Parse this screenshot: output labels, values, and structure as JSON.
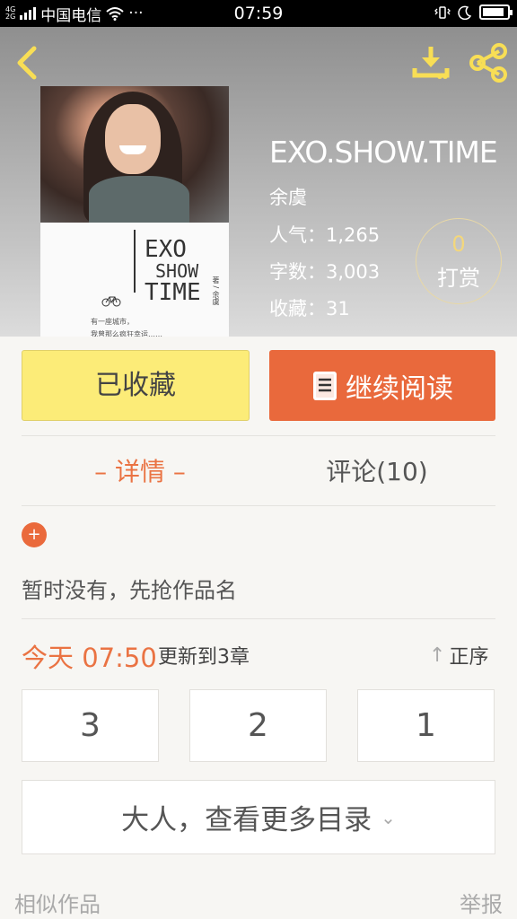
{
  "status_bar": {
    "network_top": "4G",
    "network_bottom": "2G",
    "carrier": "中国电信",
    "wifi_icon": "wifi-icon",
    "more": "···",
    "time": "07:59",
    "vibrate_icon": "vibrate-icon",
    "moon_icon": "moon-icon",
    "battery_level": 0.9
  },
  "header": {
    "back_icon": "chevron-left-icon",
    "download_icon": "download-icon",
    "share_icon": "share-icon"
  },
  "cover": {
    "title_line1": "EXO",
    "title_line2": "SHOW",
    "title_line3": "TIME",
    "bike_icon": "bicycle-icon",
    "tagline": "有一座城市，\n我曾那么疯狂幸运……",
    "author_vertical": "著 / 余虞"
  },
  "book": {
    "title": "EXO.SHOW.TIME",
    "author": "余虞",
    "popularity": "人气：1,265",
    "word_count": "字数：3,003",
    "favorites": "收藏：31"
  },
  "reward": {
    "count": "0",
    "label": "打赏"
  },
  "actions": {
    "favorited_label": "已收藏",
    "continue_label": "继续阅读",
    "book_icon": "book-icon"
  },
  "tabs": {
    "detail": "– 详情 –",
    "comments": "评论(10)"
  },
  "detail": {
    "plus": "+",
    "no_work_name": "暂时没有，先抢作品名"
  },
  "update": {
    "today": "今天 07:50",
    "text": "更新到3章",
    "sort_arrow": "↑",
    "sort_label": "正序"
  },
  "chapters": [
    "3",
    "2",
    "1"
  ],
  "more_catalog": {
    "label": "大人，查看更多目录",
    "chevron": "⌄"
  },
  "footer": {
    "similar": "相似作品",
    "report": "举报"
  },
  "colors": {
    "accent_orange": "#e9693c",
    "fav_yellow": "#fcec78"
  }
}
